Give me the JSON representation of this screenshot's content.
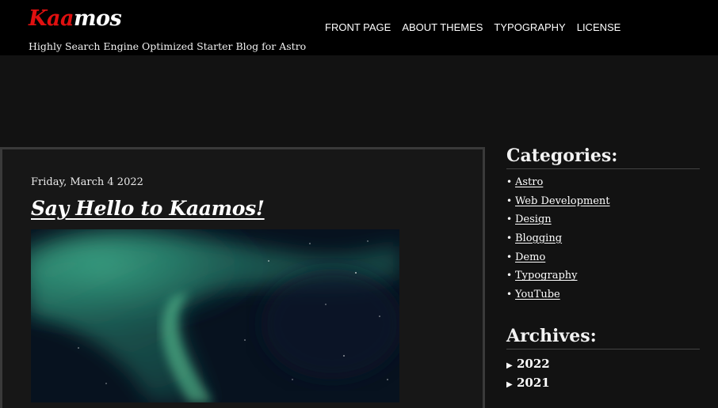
{
  "site": {
    "logo_red": "Kaa",
    "logo_white": "mos",
    "tagline": "Highly Search Engine Optimized Starter Blog for Astro"
  },
  "nav": {
    "items": [
      {
        "label": "FRONT PAGE"
      },
      {
        "label": "ABOUT THEMES"
      },
      {
        "label": "TYPOGRAPHY"
      },
      {
        "label": "LICENSE"
      }
    ]
  },
  "post": {
    "date": "Friday, March 4 2022",
    "title": "Say Hello to Kaamos!"
  },
  "sidebar": {
    "categories_title": "Categories:",
    "categories": [
      {
        "label": "Astro"
      },
      {
        "label": "Web Development"
      },
      {
        "label": "Design"
      },
      {
        "label": "Blogging"
      },
      {
        "label": "Demo"
      },
      {
        "label": "Typography"
      },
      {
        "label": "YouTube"
      }
    ],
    "archives_title": "Archives:",
    "archives": [
      {
        "label": "2022"
      },
      {
        "label": "2021"
      }
    ]
  },
  "colors": {
    "background": "#121212",
    "header": "#000000",
    "logo_accent": "#e01010",
    "aurora": "#3fae8a"
  },
  "icons": {
    "bullet": "•",
    "disclosure": "▶"
  }
}
